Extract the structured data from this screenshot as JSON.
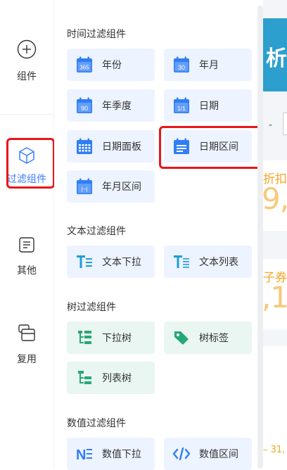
{
  "rail": {
    "items": [
      {
        "label": "组件",
        "icon": "plus-circle-icon"
      },
      {
        "label": "过滤组件",
        "icon": "cube-icon"
      },
      {
        "label": "其他",
        "icon": "document-list-icon"
      },
      {
        "label": "复用",
        "icon": "stack-icon"
      }
    ]
  },
  "sections": [
    {
      "title": "时间过滤组件",
      "items": [
        {
          "label": "年份",
          "icon": "calendar-365-icon",
          "badge": "365"
        },
        {
          "label": "年月",
          "icon": "calendar-30-icon",
          "badge": "30"
        },
        {
          "label": "年季度",
          "icon": "calendar-90-icon",
          "badge": "90"
        },
        {
          "label": "日期",
          "icon": "calendar-1-1-icon",
          "badge": "1/1"
        },
        {
          "label": "日期面板",
          "icon": "calendar-grid-icon"
        },
        {
          "label": "日期区间",
          "icon": "calendar-lines-icon"
        },
        {
          "label": "年月区间",
          "icon": "calendar-range-icon",
          "badge": "|~|"
        }
      ]
    },
    {
      "title": "文本过滤组件",
      "items": [
        {
          "label": "文本下拉",
          "icon": "text-dropdown-icon"
        },
        {
          "label": "文本列表",
          "icon": "text-list-icon"
        }
      ]
    },
    {
      "title": "树过滤组件",
      "items": [
        {
          "label": "下拉树",
          "icon": "tree-dropdown-icon"
        },
        {
          "label": "树标签",
          "icon": "tag-icon"
        },
        {
          "label": "列表树",
          "icon": "tree-list-icon"
        }
      ]
    },
    {
      "title": "数值过滤组件",
      "items": [
        {
          "label": "数值下拉",
          "icon": "number-dropdown-icon"
        },
        {
          "label": "数值区间",
          "icon": "code-range-icon"
        }
      ]
    }
  ],
  "background": {
    "banner_text": "析",
    "dash": "-",
    "card1_label": "折扣",
    "card1_value": "9,",
    "card2_label": "子券",
    "card2_value": ",1",
    "date_fragment": "– 31,"
  },
  "colors": {
    "accent": "#3d7eff",
    "highlight": "#e8161b",
    "time_card_bg": "#edf3ff",
    "text_card_bg": "#edf3ff",
    "tree_card_bg": "#e9f6f1",
    "tree_icon": "#27a876",
    "text_icon": "#1a9fd6"
  }
}
